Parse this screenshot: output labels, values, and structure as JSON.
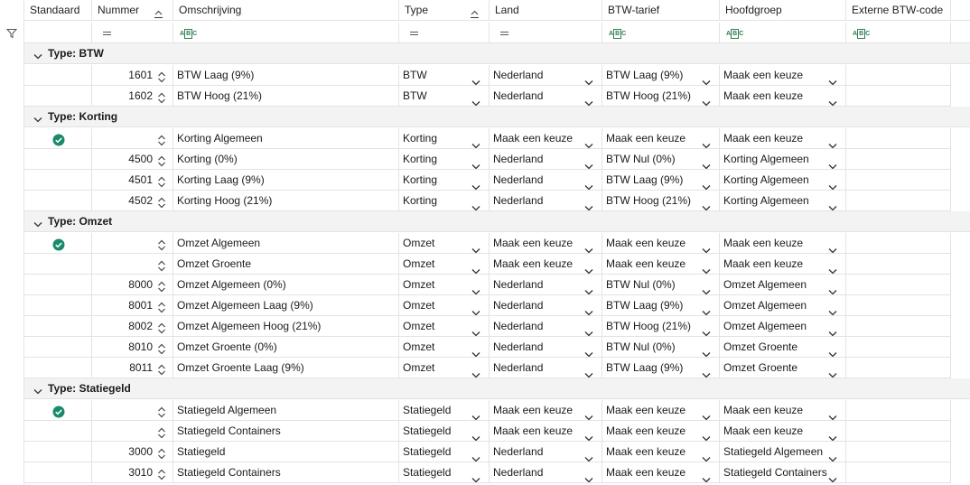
{
  "columns": [
    {
      "key": "standaard",
      "label": "Standaard"
    },
    {
      "key": "nummer",
      "label": "Nummer"
    },
    {
      "key": "omschrijving",
      "label": "Omschrijving"
    },
    {
      "key": "type",
      "label": "Type"
    },
    {
      "key": "land",
      "label": "Land"
    },
    {
      "key": "btw_tarief",
      "label": "BTW-tarief"
    },
    {
      "key": "hoofdgroep",
      "label": "Hoofdgroep"
    },
    {
      "key": "externe",
      "label": "Externe BTW-code"
    }
  ],
  "filter_icons": {
    "nummer": "equals-icon",
    "omschrijving": "text-filter-icon",
    "type": "equals-icon",
    "land": "equals-icon",
    "btw_tarief": "text-filter-icon",
    "hoofdgroep": "text-filter-icon",
    "externe": "text-filter-icon",
    "abc_glyph": "ABC"
  },
  "colors": {
    "accent": "#1a8a6a",
    "group_bg": "#f3f3f3",
    "grid_line": "#e3e3e3"
  },
  "groups": [
    {
      "title": "Type: BTW",
      "rows": [
        {
          "standaard": false,
          "nummer": "1601",
          "omschrijving": "BTW Laag (9%)",
          "type": "BTW",
          "land": "Nederland",
          "btw_tarief": "BTW Laag (9%)",
          "hoofdgroep": "Maak een keuze",
          "externe": ""
        },
        {
          "standaard": false,
          "nummer": "1602",
          "omschrijving": "BTW Hoog (21%)",
          "type": "BTW",
          "land": "Nederland",
          "btw_tarief": "BTW Hoog (21%)",
          "hoofdgroep": "Maak een keuze",
          "externe": ""
        }
      ]
    },
    {
      "title": "Type: Korting",
      "rows": [
        {
          "standaard": true,
          "nummer": "",
          "omschrijving": "Korting Algemeen",
          "type": "Korting",
          "land": "Maak een keuze",
          "btw_tarief": "Maak een keuze",
          "hoofdgroep": "Maak een keuze",
          "externe": ""
        },
        {
          "standaard": false,
          "nummer": "4500",
          "omschrijving": "Korting (0%)",
          "type": "Korting",
          "land": "Nederland",
          "btw_tarief": "BTW Nul (0%)",
          "hoofdgroep": "Korting Algemeen",
          "externe": ""
        },
        {
          "standaard": false,
          "nummer": "4501",
          "omschrijving": "Korting Laag (9%)",
          "type": "Korting",
          "land": "Nederland",
          "btw_tarief": "BTW Laag (9%)",
          "hoofdgroep": "Korting Algemeen",
          "externe": ""
        },
        {
          "standaard": false,
          "nummer": "4502",
          "omschrijving": "Korting Hoog (21%)",
          "type": "Korting",
          "land": "Nederland",
          "btw_tarief": "BTW Hoog (21%)",
          "hoofdgroep": "Korting Algemeen",
          "externe": ""
        }
      ]
    },
    {
      "title": "Type: Omzet",
      "rows": [
        {
          "standaard": true,
          "nummer": "",
          "omschrijving": "Omzet Algemeen",
          "type": "Omzet",
          "land": "Maak een keuze",
          "btw_tarief": "Maak een keuze",
          "hoofdgroep": "Maak een keuze",
          "externe": ""
        },
        {
          "standaard": false,
          "nummer": "",
          "omschrijving": "Omzet Groente",
          "type": "Omzet",
          "land": "Maak een keuze",
          "btw_tarief": "Maak een keuze",
          "hoofdgroep": "Maak een keuze",
          "externe": ""
        },
        {
          "standaard": false,
          "nummer": "8000",
          "omschrijving": "Omzet Algemeen (0%)",
          "type": "Omzet",
          "land": "Nederland",
          "btw_tarief": "BTW Nul (0%)",
          "hoofdgroep": "Omzet Algemeen",
          "externe": ""
        },
        {
          "standaard": false,
          "nummer": "8001",
          "omschrijving": "Omzet Algemeen Laag (9%)",
          "type": "Omzet",
          "land": "Nederland",
          "btw_tarief": "BTW Laag (9%)",
          "hoofdgroep": "Omzet Algemeen",
          "externe": ""
        },
        {
          "standaard": false,
          "nummer": "8002",
          "omschrijving": "Omzet Algemeen Hoog (21%)",
          "type": "Omzet",
          "land": "Nederland",
          "btw_tarief": "BTW Hoog (21%)",
          "hoofdgroep": "Omzet Algemeen",
          "externe": ""
        },
        {
          "standaard": false,
          "nummer": "8010",
          "omschrijving": "Omzet Groente (0%)",
          "type": "Omzet",
          "land": "Nederland",
          "btw_tarief": "BTW Nul (0%)",
          "hoofdgroep": "Omzet Groente",
          "externe": ""
        },
        {
          "standaard": false,
          "nummer": "8011",
          "omschrijving": "Omzet Groente Laag (9%)",
          "type": "Omzet",
          "land": "Nederland",
          "btw_tarief": "BTW Laag (9%)",
          "hoofdgroep": "Omzet Groente",
          "externe": ""
        }
      ]
    },
    {
      "title": "Type: Statiegeld",
      "rows": [
        {
          "standaard": true,
          "nummer": "",
          "omschrijving": "Statiegeld Algemeen",
          "type": "Statiegeld",
          "land": "Maak een keuze",
          "btw_tarief": "Maak een keuze",
          "hoofdgroep": "Maak een keuze",
          "externe": ""
        },
        {
          "standaard": false,
          "nummer": "",
          "omschrijving": "Statiegeld Containers",
          "type": "Statiegeld",
          "land": "Maak een keuze",
          "btw_tarief": "Maak een keuze",
          "hoofdgroep": "Maak een keuze",
          "externe": ""
        },
        {
          "standaard": false,
          "nummer": "3000",
          "omschrijving": "Statiegeld",
          "type": "Statiegeld",
          "land": "Nederland",
          "btw_tarief": "Maak een keuze",
          "hoofdgroep": "Statiegeld Algemeen",
          "externe": ""
        },
        {
          "standaard": false,
          "nummer": "3010",
          "omschrijving": "Statiegeld Containers",
          "type": "Statiegeld",
          "land": "Nederland",
          "btw_tarief": "Maak een keuze",
          "hoofdgroep": "Statiegeld Containers",
          "externe": ""
        }
      ]
    }
  ]
}
